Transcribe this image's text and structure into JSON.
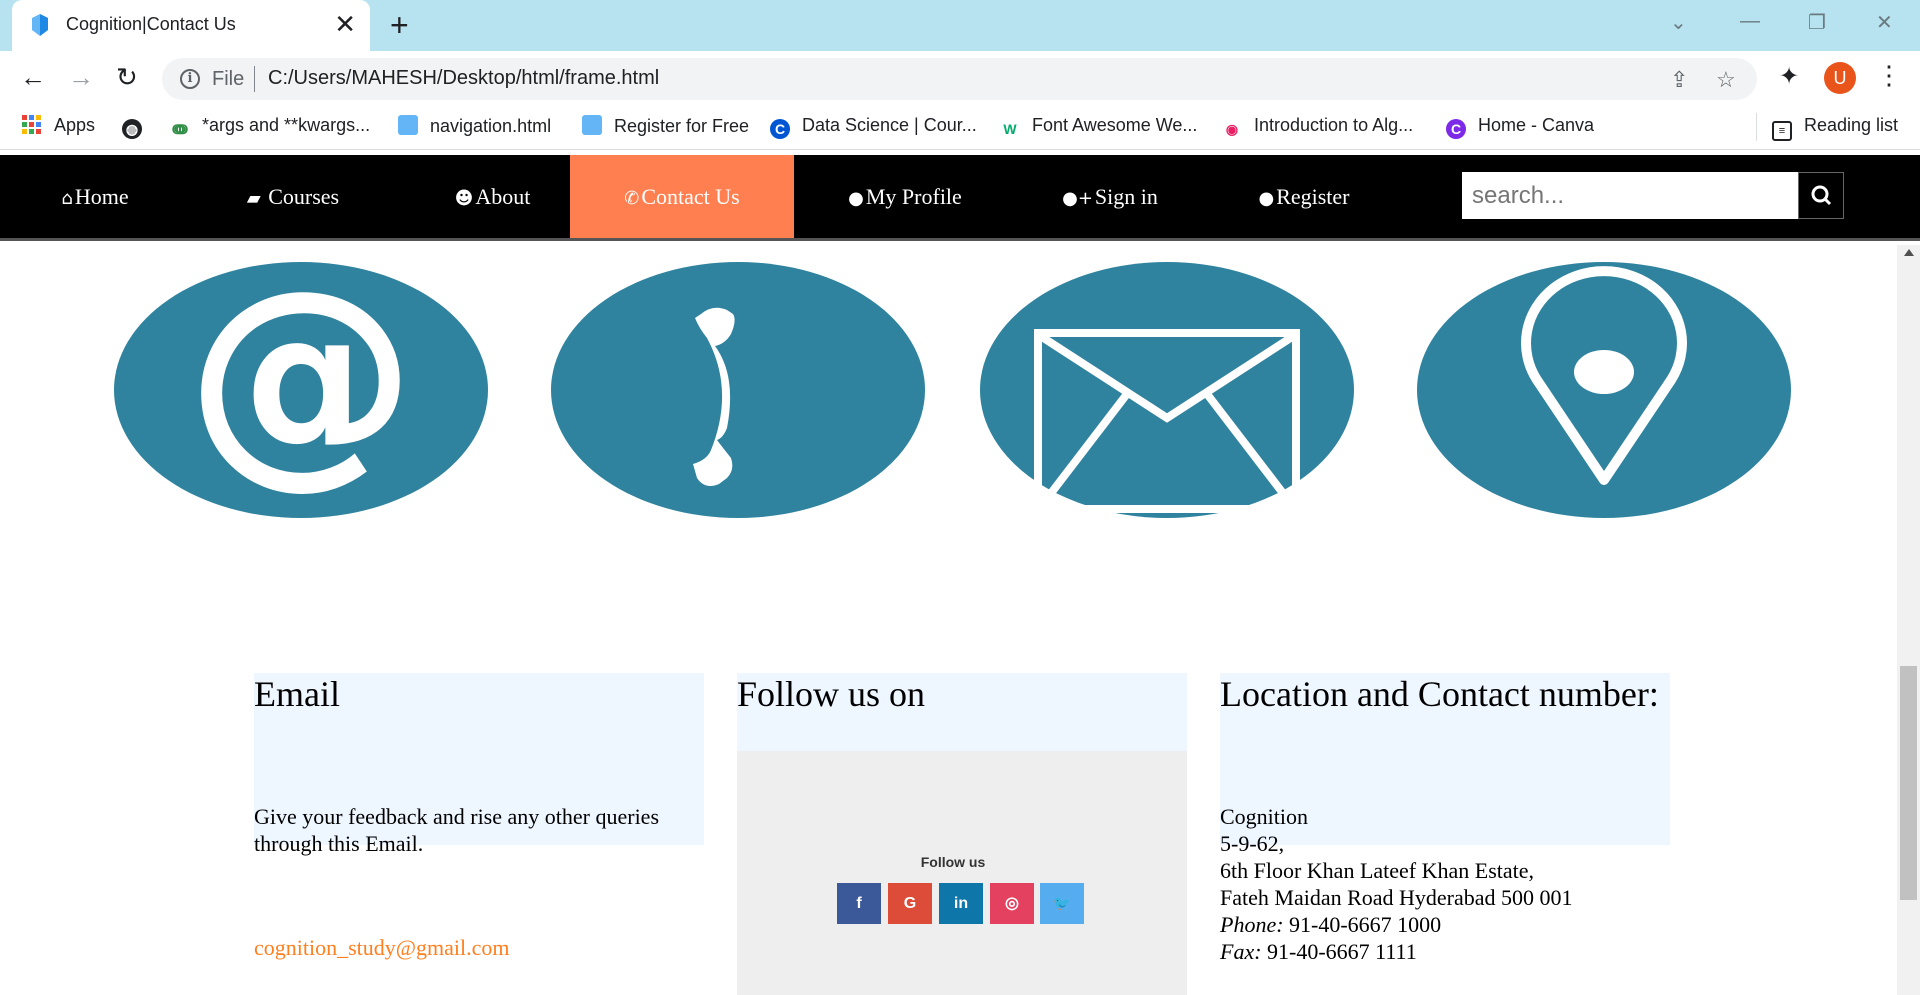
{
  "browser": {
    "tab_title": "Cognition|Contact Us",
    "url_scheme": "File",
    "url": "C:/Users/MAHESH/Desktop/html/frame.html",
    "profile_initial": "U",
    "bookmarks": [
      {
        "label": "Apps",
        "icon": "apps-grid-icon"
      },
      {
        "label": "",
        "icon": "globe-icon"
      },
      {
        "label": "*args and **kwargs...",
        "icon": "geeksforgeeks-icon"
      },
      {
        "label": "navigation.html",
        "icon": "html-file-icon"
      },
      {
        "label": "Register for Free",
        "icon": "html-file-icon"
      },
      {
        "label": "Data Science | Cour...",
        "icon": "coursera-icon"
      },
      {
        "label": "Font Awesome We...",
        "icon": "w3schools-icon"
      },
      {
        "label": "Introduction to Alg...",
        "icon": "intro-alg-icon"
      },
      {
        "label": "Home - Canva",
        "icon": "canva-icon"
      }
    ],
    "reading_list": "Reading list"
  },
  "nav": {
    "items": [
      {
        "label": "Home",
        "icon": "home-icon"
      },
      {
        "label": " Courses",
        "icon": "book-icon"
      },
      {
        "label": "About",
        "icon": "users-icon"
      },
      {
        "label": "Contact Us",
        "icon": "phone-icon",
        "active": true
      },
      {
        "label": "My Profile",
        "icon": "user-icon"
      },
      {
        "label": "Sign in",
        "icon": "user-plus-icon"
      },
      {
        "label": "Register",
        "icon": "user-icon"
      }
    ],
    "search_placeholder": "search...",
    "active_color": "#ff7f50"
  },
  "contact_icons": [
    "at-sign-icon",
    "telephone-icon",
    "envelope-icon",
    "location-pin-icon"
  ],
  "contact_icon_color": "#2f839e",
  "email_card": {
    "title": "Email",
    "text": "Give your feedback and rise any other queries through this Email.",
    "email": "cognition_study@gmail.com"
  },
  "follow_card": {
    "title": "Follow us on",
    "widget_label": "Follow us",
    "socials": [
      {
        "name": "facebook",
        "glyph": "f",
        "color": "#3b5998"
      },
      {
        "name": "google",
        "glyph": "G",
        "color": "#dd4b39"
      },
      {
        "name": "linkedin",
        "glyph": "in",
        "color": "#0e76a8"
      },
      {
        "name": "instagram",
        "glyph": "◎",
        "color": "#e4405f"
      },
      {
        "name": "twitter",
        "glyph": "🐦",
        "color": "#55acee"
      }
    ]
  },
  "location_card": {
    "title": "Location and Contact number:",
    "lines": [
      "Cognition",
      "5-9-62,",
      "6th Floor Khan Lateef Khan Estate,",
      "Fateh Maidan Road Hyderabad 500 001"
    ],
    "phone_label": "Phone:",
    "phone": " 91-40-6667 1000",
    "fax_label": "Fax:",
    "fax": " 91-40-6667 1111"
  }
}
